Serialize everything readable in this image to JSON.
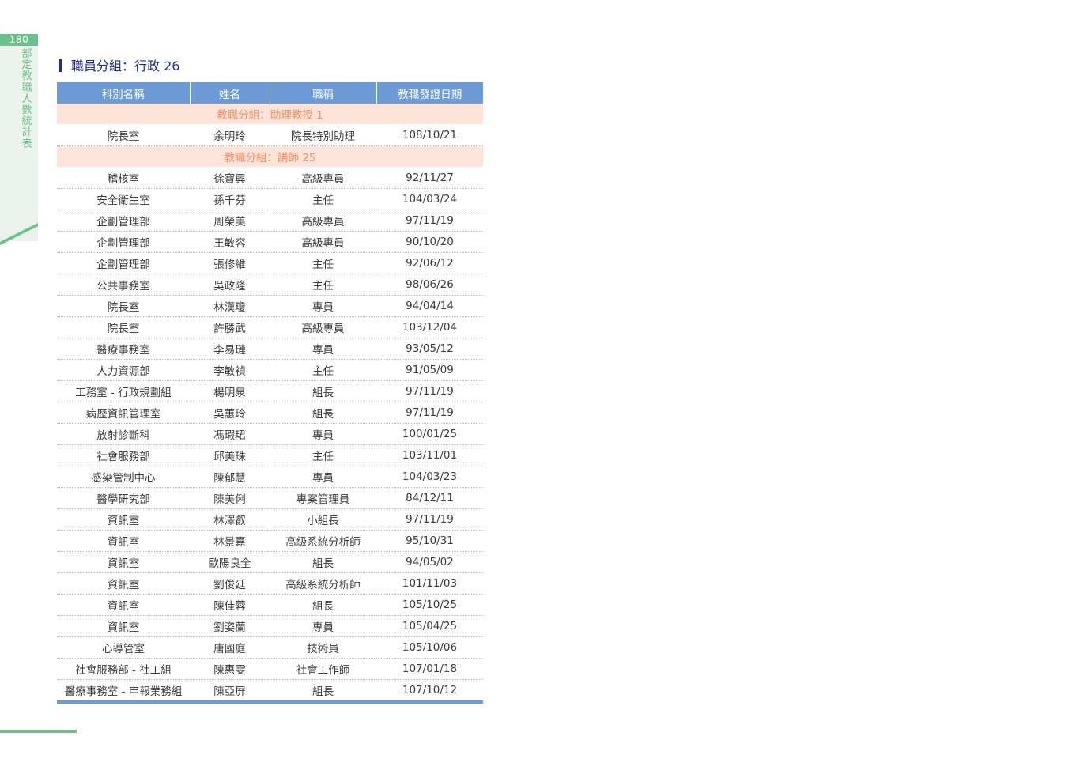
{
  "page": {
    "number": "180",
    "section_title": "部定教職人數統計表"
  },
  "heading": "職員分組：行政 26",
  "table": {
    "headers": {
      "department": "科別名稱",
      "name": "姓名",
      "title": "職稱",
      "date": "教職發證日期"
    },
    "groups": [
      {
        "label": "教職分組：助理教授 1",
        "rows": [
          {
            "department": "院長室",
            "name": "余明玲",
            "title": "院長特別助理",
            "date": "108/10/21"
          }
        ]
      },
      {
        "label": "教職分組：講師 25",
        "rows": [
          {
            "department": "稽核室",
            "name": "徐寶興",
            "title": "高級專員",
            "date": "92/11/27"
          },
          {
            "department": "安全衛生室",
            "name": "孫千芬",
            "title": "主任",
            "date": "104/03/24"
          },
          {
            "department": "企劃管理部",
            "name": "周榮美",
            "title": "高級專員",
            "date": "97/11/19"
          },
          {
            "department": "企劃管理部",
            "name": "王敏容",
            "title": "高級專員",
            "date": "90/10/20"
          },
          {
            "department": "企劃管理部",
            "name": "張修維",
            "title": "主任",
            "date": "92/06/12"
          },
          {
            "department": "公共事務室",
            "name": "吳政隆",
            "title": "主任",
            "date": "98/06/26"
          },
          {
            "department": "院長室",
            "name": "林漢瓊",
            "title": "專員",
            "date": "94/04/14"
          },
          {
            "department": "院長室",
            "name": "許勝武",
            "title": "高級專員",
            "date": "103/12/04"
          },
          {
            "department": "醫療事務室",
            "name": "李易璉",
            "title": "專員",
            "date": "93/05/12"
          },
          {
            "department": "人力資源部",
            "name": "李敏禎",
            "title": "主任",
            "date": "91/05/09"
          },
          {
            "department": "工務室 - 行政規劃組",
            "name": "楊明泉",
            "title": "組長",
            "date": "97/11/19"
          },
          {
            "department": "病歷資訊管理室",
            "name": "吳蕙玲",
            "title": "組長",
            "date": "97/11/19"
          },
          {
            "department": "放射診斷科",
            "name": "馮瑕珺",
            "title": "專員",
            "date": "100/01/25"
          },
          {
            "department": "社會服務部",
            "name": "邱美珠",
            "title": "主任",
            "date": "103/11/01"
          },
          {
            "department": "感染管制中心",
            "name": "陳郁慧",
            "title": "專員",
            "date": "104/03/23"
          },
          {
            "department": "醫學研究部",
            "name": "陳美俐",
            "title": "專案管理員",
            "date": "84/12/11"
          },
          {
            "department": "資訊室",
            "name": "林澤叡",
            "title": "小組長",
            "date": "97/11/19"
          },
          {
            "department": "資訊室",
            "name": "林景嘉",
            "title": "高級系統分析師",
            "date": "95/10/31"
          },
          {
            "department": "資訊室",
            "name": "歐陽良全",
            "title": "組長",
            "date": "94/05/02"
          },
          {
            "department": "資訊室",
            "name": "劉俊延",
            "title": "高級系統分析師",
            "date": "101/11/03"
          },
          {
            "department": "資訊室",
            "name": "陳佳蓉",
            "title": "組長",
            "date": "105/10/25"
          },
          {
            "department": "資訊室",
            "name": "劉姿蘭",
            "title": "專員",
            "date": "105/04/25"
          },
          {
            "department": "心導管室",
            "name": "唐國庭",
            "title": "技術員",
            "date": "105/10/06"
          },
          {
            "department": "社會服務部 - 社工組",
            "name": "陳惠雯",
            "title": "社會工作師",
            "date": "107/01/18"
          },
          {
            "department": "醫療事務室 - 申報業務組",
            "name": "陳亞屏",
            "title": "組長",
            "date": "107/10/12"
          }
        ]
      }
    ]
  },
  "colors": {
    "accent_green": "#6cc08b",
    "heading_navy": "#1e2d8f",
    "header_blue": "#6d9bd5",
    "group_bg": "#fde3d8",
    "group_text": "#ef8f62"
  }
}
